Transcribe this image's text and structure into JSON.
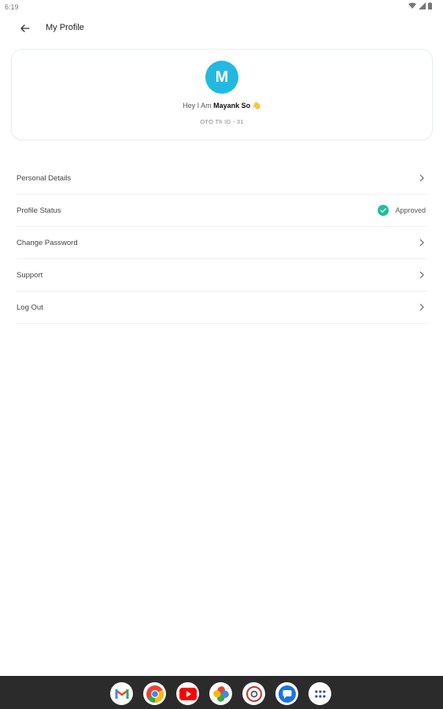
{
  "status": {
    "time": "6:19"
  },
  "header": {
    "title": "My Profile"
  },
  "profile": {
    "avatar_letter": "M",
    "greeting_prefix": "Hey I Am ",
    "name": "Mayank So",
    "emoji": "👋",
    "id_text": "OTO Th ID - 31"
  },
  "menu": {
    "items": [
      {
        "label": "Personal Details"
      },
      {
        "label": "Profile Status",
        "status": "Approved"
      },
      {
        "label": "Change Password"
      },
      {
        "label": "Support"
      },
      {
        "label": "Log Out"
      }
    ]
  },
  "dock": {
    "apps": [
      "gmail-icon",
      "chrome-icon",
      "youtube-icon",
      "photos-icon",
      "camera-icon",
      "messages-icon",
      "app-drawer-icon"
    ]
  },
  "colors": {
    "accent": "#22b9e0",
    "approved": "#1dbf9a",
    "nav_bar": "#2b2b2b"
  }
}
